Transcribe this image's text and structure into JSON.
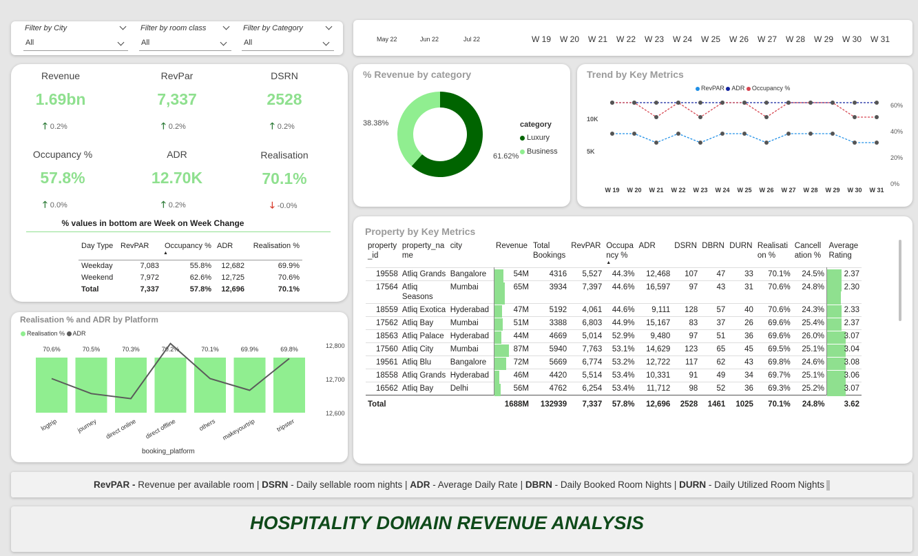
{
  "filters": [
    {
      "label": "Filter by City",
      "value": "All"
    },
    {
      "label": "Filter by room class",
      "value": "All"
    },
    {
      "label": "Filter by Category",
      "value": "All"
    }
  ],
  "timeline": {
    "months": [
      "May 22",
      "Jun 22",
      "Jul 22"
    ],
    "weeks": [
      "W 19",
      "W 20",
      "W 21",
      "W 22",
      "W 23",
      "W 24",
      "W 25",
      "W 26",
      "W 27",
      "W 28",
      "W 29",
      "W 30",
      "W 31"
    ]
  },
  "kpis": [
    {
      "title": "Revenue",
      "value": "1.69bn",
      "change": "0.2%",
      "dir": "up"
    },
    {
      "title": "RevPar",
      "value": "7,337",
      "change": "0.2%",
      "dir": "up"
    },
    {
      "title": "DSRN",
      "value": "2528",
      "change": "0.2%",
      "dir": "up"
    },
    {
      "title": "Occupancy %",
      "value": "57.8%",
      "change": "0.0%",
      "dir": "up"
    },
    {
      "title": "ADR",
      "value": "12.70K",
      "change": "0.2%",
      "dir": "up"
    },
    {
      "title": "Realisation",
      "value": "70.1%",
      "change": "-0.0%",
      "dir": "down"
    }
  ],
  "kpi_note": "% values in bottom are Week on Week Change",
  "daytype_table": {
    "headers": [
      "Day Type",
      "RevPAR",
      "Occupancy %",
      "ADR",
      "Realisation %"
    ],
    "rows": [
      [
        "Weekday",
        "7,083",
        "55.8%",
        "12,682",
        "69.9%"
      ],
      [
        "Weekend",
        "7,972",
        "62.6%",
        "12,725",
        "70.6%"
      ]
    ],
    "total": [
      "Total",
      "7,337",
      "57.8%",
      "12,696",
      "70.1%"
    ]
  },
  "category_chart": {
    "title": "% Revenue by category",
    "legend_title": "category",
    "colors": {
      "Luxury": "#006400",
      "Business": "#90ee90"
    },
    "chart_data": {
      "type": "pie",
      "donut": true,
      "categories": [
        "Luxury",
        "Business"
      ],
      "values": [
        61.62,
        38.38
      ],
      "labels": [
        "61.62%",
        "38.38%"
      ],
      "legend": "right"
    }
  },
  "trend_chart": {
    "title": "Trend by Key Metrics",
    "colors": {
      "RevPAR": "#1f8fe6",
      "ADR": "#12239e",
      "Occupancy %": "#d64550"
    },
    "left_ticks": [
      "10K",
      "5K"
    ],
    "right_ticks": [
      "60%",
      "40%",
      "20%",
      "0%"
    ],
    "chart_data": {
      "type": "line",
      "x": [
        "W 19",
        "W 20",
        "W 21",
        "W 22",
        "W 23",
        "W 24",
        "W 25",
        "W 26",
        "W 27",
        "W 28",
        "W 29",
        "W 30",
        "W 31"
      ],
      "series": [
        {
          "name": "RevPAR",
          "axis": "left",
          "values": [
            7600,
            7600,
            7000,
            7600,
            7000,
            7600,
            7600,
            7000,
            7600,
            7600,
            7600,
            7000,
            7000
          ]
        },
        {
          "name": "ADR",
          "axis": "left",
          "values": [
            12700,
            12700,
            12700,
            12700,
            12700,
            12700,
            12700,
            12700,
            12700,
            12700,
            12700,
            12700,
            12700
          ]
        },
        {
          "name": "Occupancy %",
          "axis": "right",
          "values": [
            61,
            61,
            51,
            61,
            51,
            61,
            61,
            51,
            61,
            61,
            61,
            51,
            51
          ]
        }
      ],
      "legend": "top"
    }
  },
  "platform_chart": {
    "title": "Realisation % and ADR by Platform",
    "xlabel": "booking_platform",
    "right_ticks": [
      "12,800",
      "12,700",
      "12,600"
    ],
    "colors": {
      "Realisation %": "#90ee90",
      "ADR": "#5a5a5a"
    },
    "chart_data": {
      "type": "bar",
      "categories": [
        "logtrip",
        "journey",
        "direct online",
        "direct offline",
        "others",
        "makeyourtrip",
        "tripster"
      ],
      "series": [
        {
          "name": "Realisation %",
          "values": [
            70.6,
            70.5,
            70.3,
            70.2,
            70.1,
            69.9,
            69.8
          ],
          "labels": [
            "70.6%",
            "70.5%",
            "70.3%",
            "70.2%",
            "70.1%",
            "69.9%",
            "69.8%"
          ]
        },
        {
          "name": "ADR",
          "type": "line",
          "axis": "right",
          "values": [
            12700,
            12655,
            12640,
            12805,
            12700,
            12665,
            12760
          ]
        }
      ],
      "ylim_right": [
        12600,
        12800
      ]
    }
  },
  "property_table": {
    "title": "Property by Key Metrics",
    "headers": [
      "property _id",
      "property_na me",
      "city",
      "Revenue",
      "Total Bookings",
      "RevPAR",
      "Occupa ncy %",
      "ADR",
      "DSRN",
      "DBRN",
      "DURN",
      "Realisati on %",
      "Cancell ation %",
      "Average Rating"
    ],
    "rows": [
      {
        "id": "19558",
        "name": "Atliq Grands",
        "city": "Bangalore",
        "revenue": "54M",
        "rev_pct": 0.62,
        "bookings": "4316",
        "revpar": "5,527",
        "occ": "44.3%",
        "adr": "12,468",
        "dsrn": "107",
        "dbrn": "47",
        "durn": "33",
        "real": "70.1%",
        "canc": "24.5%",
        "rating": "2.37",
        "rating_pct": 0.77
      },
      {
        "id": "17564",
        "name": "Atliq Seasons",
        "city": "Mumbai",
        "revenue": "65M",
        "rev_pct": 0.75,
        "bookings": "3934",
        "revpar": "7,397",
        "occ": "44.6%",
        "adr": "16,597",
        "dsrn": "97",
        "dbrn": "43",
        "durn": "31",
        "real": "70.6%",
        "canc": "24.8%",
        "rating": "2.30",
        "rating_pct": 0.75
      },
      {
        "id": "18559",
        "name": "Atliq Exotica",
        "city": "Hyderabad",
        "revenue": "47M",
        "rev_pct": 0.54,
        "bookings": "5192",
        "revpar": "4,061",
        "occ": "44.6%",
        "adr": "9,111",
        "dsrn": "128",
        "dbrn": "57",
        "durn": "40",
        "real": "70.6%",
        "canc": "24.3%",
        "rating": "2.33",
        "rating_pct": 0.76
      },
      {
        "id": "17562",
        "name": "Atliq Bay",
        "city": "Mumbai",
        "revenue": "51M",
        "rev_pct": 0.59,
        "bookings": "3388",
        "revpar": "6,803",
        "occ": "44.9%",
        "adr": "15,167",
        "dsrn": "83",
        "dbrn": "37",
        "durn": "26",
        "real": "69.6%",
        "canc": "25.4%",
        "rating": "2.37",
        "rating_pct": 0.77
      },
      {
        "id": "18563",
        "name": "Atliq Palace",
        "city": "Hyderabad",
        "revenue": "44M",
        "rev_pct": 0.51,
        "bookings": "4669",
        "revpar": "5,014",
        "occ": "52.9%",
        "adr": "9,480",
        "dsrn": "97",
        "dbrn": "51",
        "durn": "36",
        "real": "69.6%",
        "canc": "26.0%",
        "rating": "3.07",
        "rating_pct": 1.0
      },
      {
        "id": "17560",
        "name": "Atliq City",
        "city": "Mumbai",
        "revenue": "87M",
        "rev_pct": 1.0,
        "bookings": "5940",
        "revpar": "7,763",
        "occ": "53.1%",
        "adr": "14,629",
        "dsrn": "123",
        "dbrn": "65",
        "durn": "45",
        "real": "69.5%",
        "canc": "25.1%",
        "rating": "3.04",
        "rating_pct": 0.99
      },
      {
        "id": "19561",
        "name": "Atliq Blu",
        "city": "Bangalore",
        "revenue": "72M",
        "rev_pct": 0.83,
        "bookings": "5669",
        "revpar": "6,774",
        "occ": "53.2%",
        "adr": "12,722",
        "dsrn": "117",
        "dbrn": "62",
        "durn": "43",
        "real": "69.8%",
        "canc": "24.6%",
        "rating": "3.08",
        "rating_pct": 1.0
      },
      {
        "id": "18558",
        "name": "Atliq Grands",
        "city": "Hyderabad",
        "revenue": "46M",
        "rev_pct": 0.36,
        "bookings": "4420",
        "revpar": "5,514",
        "occ": "53.4%",
        "adr": "10,331",
        "dsrn": "91",
        "dbrn": "49",
        "durn": "34",
        "real": "69.7%",
        "canc": "25.1%",
        "rating": "3.06",
        "rating_pct": 0.99
      },
      {
        "id": "16562",
        "name": "Atliq Bay",
        "city": "Delhi",
        "revenue": "56M",
        "rev_pct": 0.43,
        "bookings": "4762",
        "revpar": "6,254",
        "occ": "53.4%",
        "adr": "11,712",
        "dsrn": "98",
        "dbrn": "52",
        "durn": "36",
        "real": "69.3%",
        "canc": "25.2%",
        "rating": "3.07",
        "rating_pct": 1.0
      }
    ],
    "total": {
      "label": "Total",
      "revenue": "1688M",
      "bookings": "132939",
      "revpar": "7,337",
      "occ": "57.8%",
      "adr": "12,696",
      "dsrn": "2528",
      "dbrn": "1461",
      "durn": "1025",
      "real": "70.1%",
      "canc": "24.8%",
      "rating": "3.62"
    }
  },
  "glossary": [
    {
      "term": "RevPAR -",
      "desc": " Revenue per available room | "
    },
    {
      "term": "DSRN",
      "desc": " - Daily sellable room nights | "
    },
    {
      "term": "ADR",
      "desc": " - Average Daily Rate | "
    },
    {
      "term": "DBRN",
      "desc": " - Daily Booked Room Nights | "
    },
    {
      "term": "DURN",
      "desc": " - Daily Utilized Room Nights"
    }
  ],
  "page_title": "HOSPITALITY DOMAIN REVENUE ANALYSIS"
}
